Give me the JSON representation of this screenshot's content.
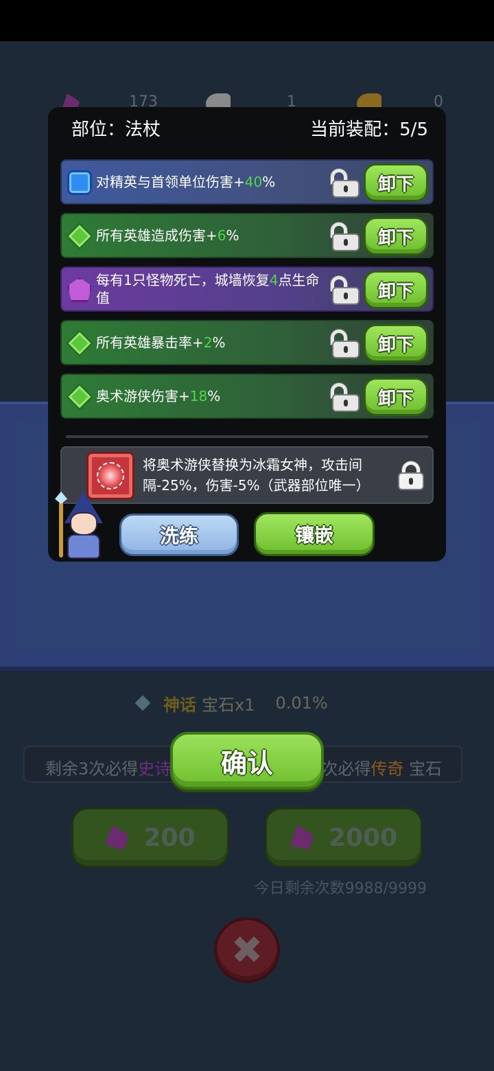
{
  "resources": [
    {
      "icon": "gem-icon",
      "value": "173"
    },
    {
      "icon": "silver-key-icon",
      "value": "1"
    },
    {
      "icon": "gold-key-icon",
      "value": "0"
    }
  ],
  "dialog": {
    "slot_label": "部位：法杖",
    "equip_count": "当前装配：5/5",
    "rows": [
      {
        "type": "blue",
        "icon": "blue-gem-icon",
        "pre": "对精英与首领单位伤害+",
        "value": "40",
        "post": "%",
        "button": "卸下"
      },
      {
        "type": "green",
        "icon": "green-gem-icon",
        "pre": "所有英雄造成伤害+",
        "value": "6",
        "post": "%",
        "button": "卸下"
      },
      {
        "type": "purple",
        "icon": "purple-gem-icon",
        "pre": "每有1只怪物死亡，城墙恢复",
        "value": "4",
        "post": "点生命值",
        "button": "卸下"
      },
      {
        "type": "green",
        "icon": "green-gem-icon",
        "pre": "所有英雄暴击率+",
        "value": "2",
        "post": "%",
        "button": "卸下"
      },
      {
        "type": "green",
        "icon": "green-gem-icon",
        "pre": "奥术游侠伤害+",
        "value": "18",
        "post": "%",
        "button": "卸下"
      }
    ],
    "special": {
      "icon": "red-rune-gem-icon",
      "text": "将奥术游侠替换为冰霜女神，攻击间隔-25%，伤害-5%（武器部位唯一）"
    },
    "reroll_label": "洗练",
    "inlay_label": "镶嵌"
  },
  "background": {
    "odds_mythic_rarity": "神话",
    "odds_mythic_label": "宝石x1",
    "odds_mythic_value": "0.01%",
    "pity_left_pre": "剩余3次必得",
    "pity_left_rarity": "史诗",
    "pity_right_pre": "次必得",
    "pity_right_rarity": "传奇",
    "pity_right_post": "宝石",
    "draw_single": "200",
    "draw_ten": "2000",
    "daily_remaining": "今日剩余次数9988/9999"
  },
  "confirm_label": "确认",
  "colors": {
    "accent_green": "#7bcf3a",
    "highlight_value": "#4fd64a",
    "dialog_bg": "#0d0e10"
  }
}
